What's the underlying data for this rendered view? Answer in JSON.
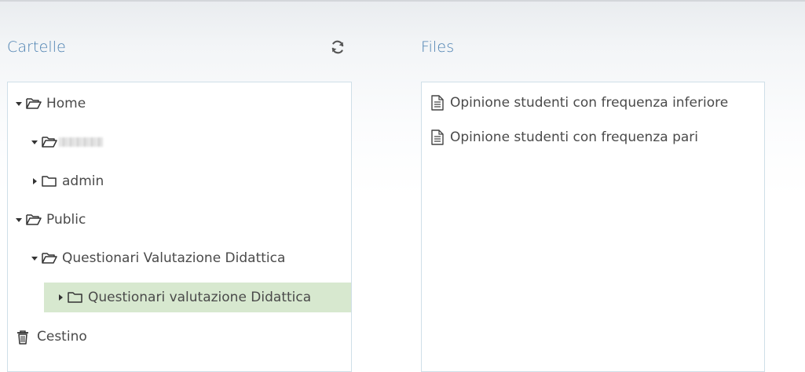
{
  "folders_panel": {
    "title": "Cartelle",
    "refresh_icon": "refresh-icon",
    "tree": [
      {
        "label": "Home",
        "expanded": true,
        "icon": "folder-open-icon"
      },
      {
        "label": "",
        "expanded": true,
        "icon": "folder-open-icon",
        "redacted": true
      },
      {
        "label": "admin",
        "expanded": false,
        "icon": "folder-icon"
      },
      {
        "label": "Public",
        "expanded": true,
        "icon": "folder-open-icon"
      },
      {
        "label": "Questionari Valutazione Didattica",
        "expanded": true,
        "icon": "folder-open-icon"
      },
      {
        "label": "Questionari valutazione Didattica",
        "expanded": false,
        "icon": "folder-icon",
        "selected": true
      },
      {
        "label": "Cestino",
        "icon": "trash-icon"
      }
    ]
  },
  "files_panel": {
    "title": "Files",
    "files": [
      {
        "name": "Opinione studenti con frequenza inferiore",
        "icon": "file-icon"
      },
      {
        "name": "Opinione studenti con frequenza pari",
        "icon": "file-icon"
      }
    ]
  },
  "colors": {
    "title_blue": "#4a7fb0",
    "selected_bg": "#d7e8cf",
    "panel_border": "#cfdfe8"
  }
}
